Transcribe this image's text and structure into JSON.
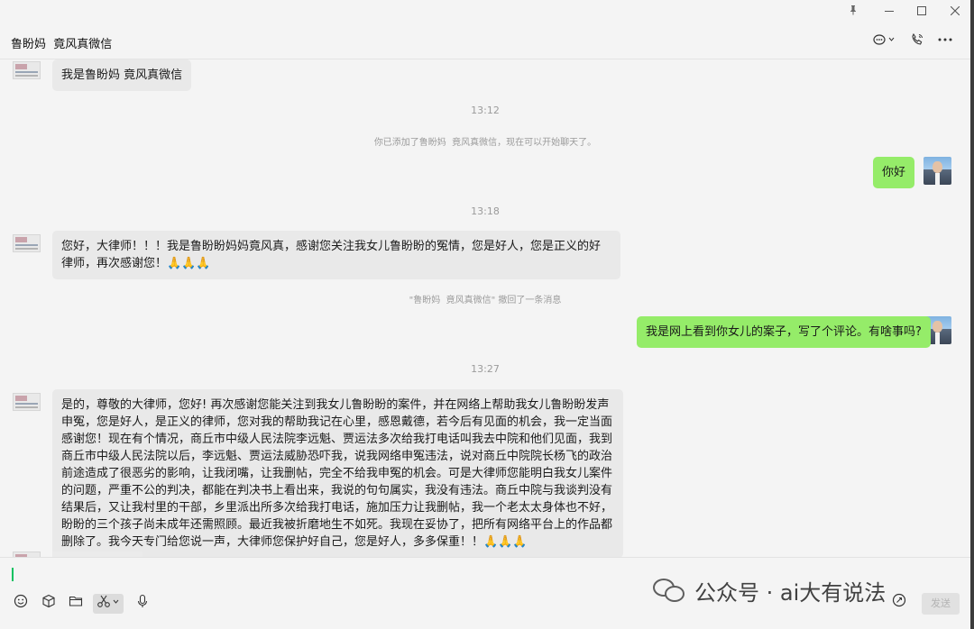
{
  "window": {
    "pin_icon": "pin-icon",
    "min_icon": "minimize-icon",
    "max_icon": "maximize-icon",
    "close_icon": "close-icon"
  },
  "header": {
    "title": "鲁盼妈  竟风真微信",
    "icons": [
      "chat-menu-icon",
      "call-icon",
      "more-icon"
    ]
  },
  "messages": {
    "m1": "我是鲁盼妈  竟风真微信",
    "t1": "13:12",
    "sys1": "你已添加了鲁盼妈  竟风真微信，现在可以开始聊天了。",
    "me1": "你好",
    "t2": "13:18",
    "m2": "您好，大律师！！！我是鲁盼盼妈妈竟风真，感谢您关注我女儿鲁盼盼的冤情，您是好人，您是正义的好律师，再次感谢您！🙏🙏🙏",
    "sys2": "\"鲁盼妈  竟风真微信\" 撤回了一条消息",
    "me2": "我是网上看到你女儿的案子，写了个评论。有啥事吗?",
    "t3": "13:27",
    "m3": "是的，尊敬的大律师，您好!      再次感谢您能关注到我女儿鲁盼盼的案件，并在网络上帮助我女儿鲁盼盼发声申冤，您是好人，是正义的律师，您对我的帮助我记在心里，感恩戴德，若今后有见面的机会，我一定当面感谢您！现在有个情况，商丘市中级人民法院李远魁、贾运法多次给我打电话叫我去中院和他们见面，我到商丘市中级人民法院以后，李远魁、贾运法威胁恐吓我，说我网络申冤违法，说对商丘中院院长杨飞的政治前途造成了很恶劣的影响，让我闭嘴，让我删帖，完全不给我申冤的机会。可是大律师您能明白我女儿案件的问题，严重不公的判决，都能在判决书上看出来，我说的句句属实，我没有违法。商丘中院与我谈判没有结果后，又让我村里的干部，乡里派出所多次给我打电话，施加压力让我删帖，我一个老太太身体也不好，盼盼的三个孩子尚未成年还需照顾。最近我被折磨地生不如死。我现在妥协了，把所有网络平台上的作品都删除了。我今天专门给您说一声，大律师您保护好自己，您是好人，多多保重！！🙏🙏🙏"
  },
  "toolbar": {
    "icons": [
      "emoji-icon",
      "box-icon",
      "folder-icon",
      "scissors-icon",
      "mic-icon"
    ],
    "send_label": "发送"
  },
  "watermark": {
    "text": "公众号 · ai大有说法"
  }
}
